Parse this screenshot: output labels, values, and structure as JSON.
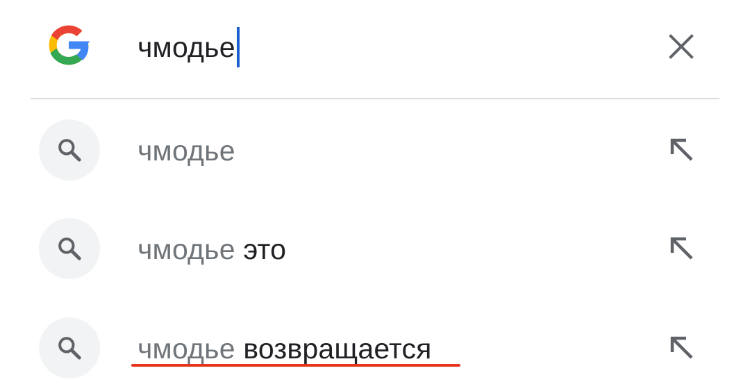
{
  "search": {
    "query": "чмодье",
    "logo": "google-g-logo",
    "clear_icon": "close-icon"
  },
  "suggestions": [
    {
      "prefix": "чмодье",
      "suffix": "",
      "icon": "search-icon",
      "fill_icon": "arrow-up-left-icon"
    },
    {
      "prefix": "чмодье",
      "suffix": " это",
      "icon": "search-icon",
      "fill_icon": "arrow-up-left-icon"
    },
    {
      "prefix": "чмодье",
      "suffix": " возвращается",
      "icon": "search-icon",
      "fill_icon": "arrow-up-left-icon"
    }
  ],
  "colors": {
    "caret": "#1a5fd0",
    "annotation_underline": "#e8341c",
    "prefix_text": "#70757a",
    "suffix_text": "#202124"
  }
}
